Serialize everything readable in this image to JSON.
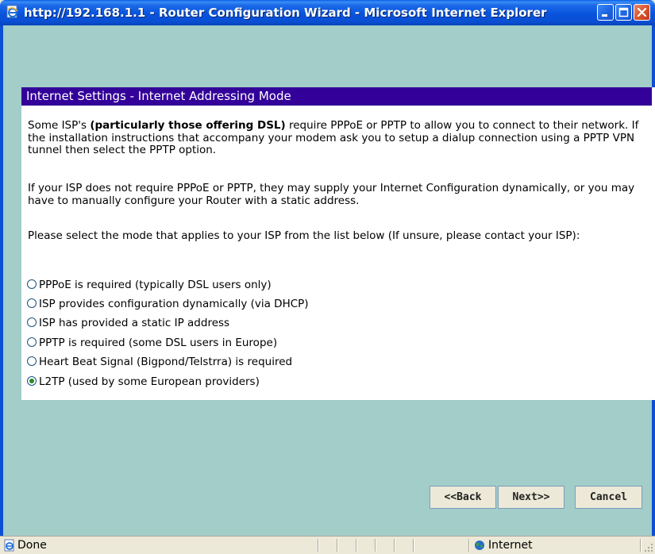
{
  "window": {
    "title": "http://192.168.1.1 - Router Configuration Wizard - Microsoft Internet Explorer",
    "icon": "ie-page-icon",
    "buttons": [
      "minimize-icon",
      "maximize-icon",
      "close-icon"
    ]
  },
  "panel": {
    "header": "Internet Settings - Internet Addressing Mode",
    "para1_pre": "Some ISP's ",
    "para1_bold": "(particularly those offering DSL)",
    "para1_post": " require PPPoE or PPTP to allow you to connect to their network. If the installation instructions that accompany your modem ask you to setup a dialup connection using a PPTP VPN tunnel then select the PPTP option.",
    "para2": "If your ISP does not require PPPoE or PPTP, they may supply your Internet Configuration dynamically, or you may have to manually configure your Router with a static address.",
    "para3": "Please select the mode that applies to your ISP from the list below (If unsure, please contact your ISP):",
    "options": [
      {
        "label": "PPPoE is required (typically DSL users only)",
        "checked": false
      },
      {
        "label": "ISP provides configuration dynamically (via DHCP)",
        "checked": false
      },
      {
        "label": "ISP has provided a static IP address",
        "checked": false
      },
      {
        "label": "PPTP is required (some DSL users in Europe)",
        "checked": false
      },
      {
        "label": "Heart Beat Signal (Bigpond/Telstrra) is required",
        "checked": false
      },
      {
        "label": "L2TP (used by some European providers)",
        "checked": true
      }
    ]
  },
  "buttons": {
    "back": "<<Back",
    "next": "Next>>",
    "cancel": "Cancel"
  },
  "statusbar": {
    "status": "Done",
    "zone": "Internet"
  },
  "colors": {
    "content_bg": "#a2cdc9",
    "header_bg": "#330099",
    "titlebar": "#0a4fd4"
  }
}
